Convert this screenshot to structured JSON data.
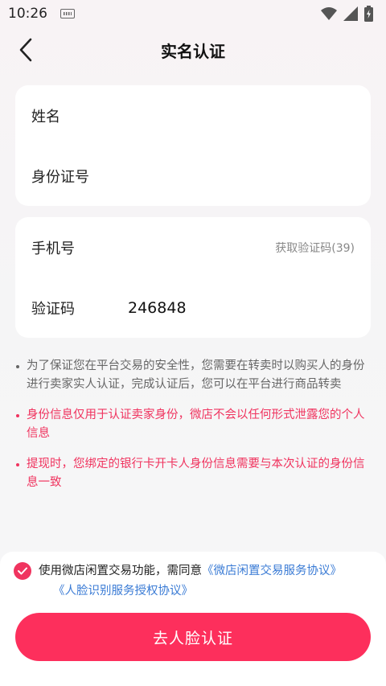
{
  "status_bar": {
    "time": "10:26"
  },
  "header": {
    "title": "实名认证"
  },
  "identity_card": {
    "name_label": "姓名",
    "id_label": "身份证号"
  },
  "phone_card": {
    "phone_label": "手机号",
    "get_code": "获取验证码(39)",
    "code_label": "验证码",
    "code_value": "246848"
  },
  "notes": [
    "为了保证您在平台交易的安全性，您需要在转卖时以购买人的身份进行卖家实人认证，完成认证后，您可以在平台进行商品转卖",
    "身份信息仅用于认证卖家身份，微店不会以任何形式泄露您的个人信息",
    "提现时，您绑定的银行卡开卡人身份信息需要与本次认证的身份信息一致"
  ],
  "agreement": {
    "text": "使用微店闲置交易功能，需同意",
    "link1": "《微店闲置交易服务协议》",
    "link2": "《人脸识别服务授权协议》",
    "checked": true
  },
  "primary_button": "去人脸认证",
  "colors": {
    "accent": "#fd2f5c",
    "link": "#3a7bd5",
    "warning": "#f0345f"
  }
}
